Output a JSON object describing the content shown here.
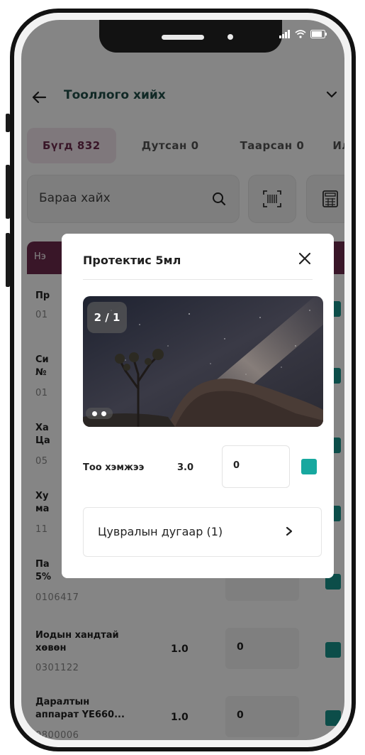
{
  "header": {
    "title": "Тооллого хийх"
  },
  "tabs": [
    {
      "label": "Бүгд 832"
    },
    {
      "label": "Дутсан 0"
    },
    {
      "label": "Таарсан 0"
    },
    {
      "label": "Ил"
    }
  ],
  "search": {
    "placeholder": "Бараа хайх"
  },
  "table": {
    "header_label": "Нэ",
    "rows": [
      {
        "name": "Пр",
        "code": "01",
        "qty": "",
        "count": ""
      },
      {
        "name": "Си\n№",
        "code": "01",
        "qty": "",
        "count": ""
      },
      {
        "name": "Ха\nЦа",
        "code": "05",
        "qty": "",
        "count": ""
      },
      {
        "name": "Ху\nма",
        "code": "11",
        "qty": "",
        "count": ""
      },
      {
        "name": "Па\n5%",
        "code": "0106417",
        "qty": "",
        "count": ""
      },
      {
        "name": "Иодын хандтай\nхөвөн",
        "code": "0301122",
        "qty": "1.0",
        "count": "0"
      },
      {
        "name": "Даралтын\nаппарат YE660...",
        "code": "0800006",
        "qty": "1.0",
        "count": "0"
      }
    ]
  },
  "modal": {
    "title": "Протектис 5мл",
    "image_counter": "2 / 1",
    "qty_label": "Тоо хэмжээ",
    "qty_value": "3.0",
    "input_value": "0",
    "serial_label": "Цувралын дугаар (1)"
  },
  "colors": {
    "accent": "#6d2b4d",
    "teal": "#17948c",
    "title_text": "#22504a"
  }
}
